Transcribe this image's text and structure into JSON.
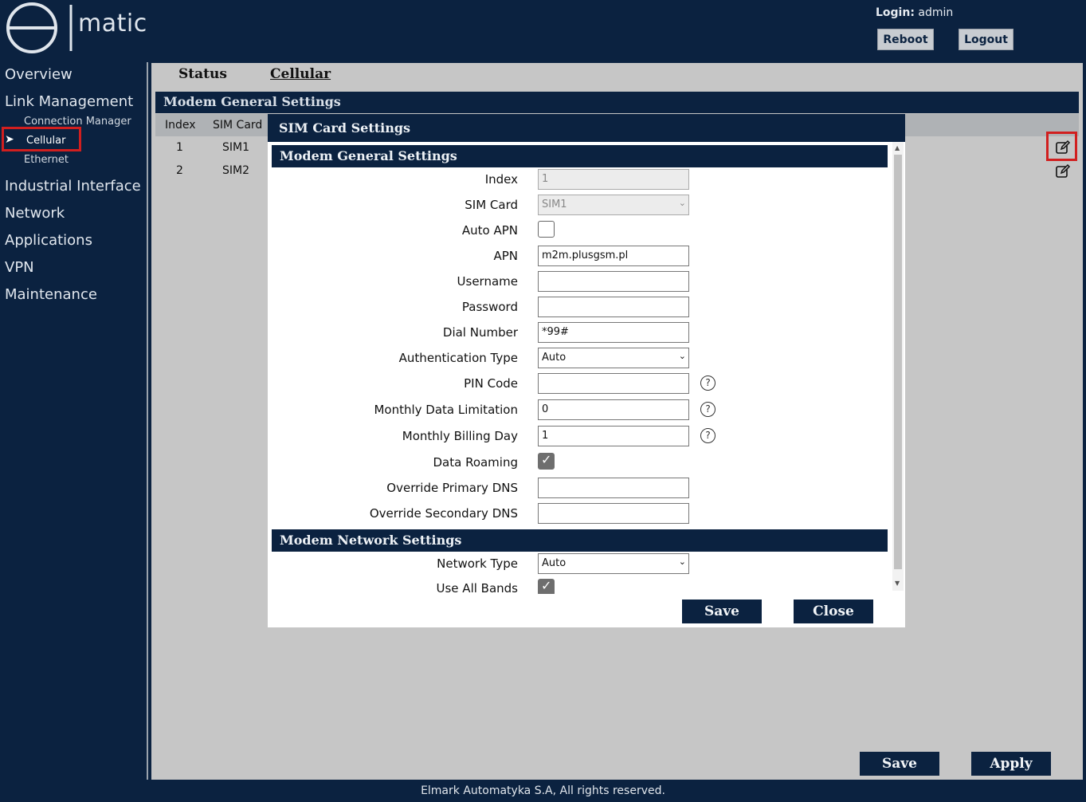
{
  "header": {
    "logo_text": "matic",
    "login_label": "Login:",
    "login_user": "admin",
    "reboot_label": "Reboot",
    "logout_label": "Logout"
  },
  "sidebar": {
    "items": [
      {
        "label": "Overview"
      },
      {
        "label": "Link Management"
      },
      {
        "label": "Connection Manager"
      },
      {
        "label": "Cellular"
      },
      {
        "label": "Ethernet"
      },
      {
        "label": "Industrial Interface"
      },
      {
        "label": "Network"
      },
      {
        "label": "Applications"
      },
      {
        "label": "VPN"
      },
      {
        "label": "Maintenance"
      }
    ],
    "active_arrow": "➤"
  },
  "main": {
    "tabs": [
      {
        "label": "Status"
      },
      {
        "label": "Cellular"
      }
    ],
    "section_title": "Modem General Settings",
    "table": {
      "headers": [
        "Index",
        "SIM Card"
      ],
      "rows": [
        {
          "index": "1",
          "sim": "SIM1"
        },
        {
          "index": "2",
          "sim": "SIM2"
        }
      ]
    },
    "save_label": "Save",
    "apply_label": "Apply"
  },
  "modal": {
    "title": "SIM Card Settings",
    "general_title": "Modem General Settings",
    "fields": {
      "index": {
        "label": "Index",
        "value": "1"
      },
      "sim_card": {
        "label": "SIM Card",
        "value": "SIM1"
      },
      "auto_apn": {
        "label": "Auto APN",
        "checked": false
      },
      "apn": {
        "label": "APN",
        "value": "m2m.plusgsm.pl"
      },
      "username": {
        "label": "Username",
        "value": ""
      },
      "password": {
        "label": "Password",
        "value": ""
      },
      "dial_number": {
        "label": "Dial Number",
        "value": "*99#"
      },
      "auth_type": {
        "label": "Authentication Type",
        "value": "Auto"
      },
      "pin_code": {
        "label": "PIN Code",
        "value": ""
      },
      "monthly_limit": {
        "label": "Monthly Data Limitation",
        "value": "0"
      },
      "billing_day": {
        "label": "Monthly Billing Day",
        "value": "1"
      },
      "data_roaming": {
        "label": "Data Roaming",
        "checked": true
      },
      "primary_dns": {
        "label": "Override Primary DNS",
        "value": ""
      },
      "secondary_dns": {
        "label": "Override Secondary DNS",
        "value": ""
      }
    },
    "network_title": "Modem Network Settings",
    "network_fields": {
      "network_type": {
        "label": "Network Type",
        "value": "Auto"
      },
      "use_all_bands": {
        "label": "Use All Bands",
        "checked": true
      }
    },
    "save_label": "Save",
    "close_label": "Close"
  },
  "icons": {
    "help_glyph": "?",
    "select_arrow": "⌄",
    "check_glyph": "✓",
    "scroll_up": "▲",
    "scroll_down": "▼"
  },
  "footer": {
    "text": "Elmark Automatyka S.A, All rights reserved."
  },
  "colors": {
    "navy": "#0b2240",
    "panel": "#c6c6c6",
    "highlight_red": "#d11f1f"
  }
}
